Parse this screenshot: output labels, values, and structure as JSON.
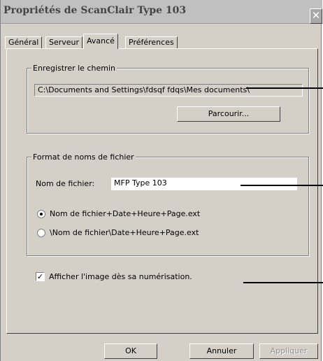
{
  "window": {
    "title": "Propriétés de ScanClair Type 103",
    "close_glyph": "✕"
  },
  "tabs": [
    {
      "label": "Général"
    },
    {
      "label": "Serveur"
    },
    {
      "label": "Avancé"
    },
    {
      "label": "Préférences"
    }
  ],
  "save_path": {
    "group_label": "Enregistrer le chemin",
    "path": "C:\\Documents and Settings\\fdsqf fdqs\\Mes documents\\",
    "browse_label": "Parcourir..."
  },
  "file_name_format": {
    "group_label": "Format de noms de fichier",
    "name_label": "Nom de fichier:",
    "name_value": "MFP Type 103",
    "option1_label": "Nom de fichier+Date+Heure+Page.ext",
    "option2_label": "\\Nom de fichier\\Date+Heure+Page.ext",
    "selected_option": 1
  },
  "show_image": {
    "label": "Afficher l'image dès sa numérisation.",
    "checked": true,
    "check_glyph": "✓"
  },
  "footer": {
    "ok_label": "OK",
    "cancel_label": "Annuler",
    "apply_label": "Appliquer"
  }
}
